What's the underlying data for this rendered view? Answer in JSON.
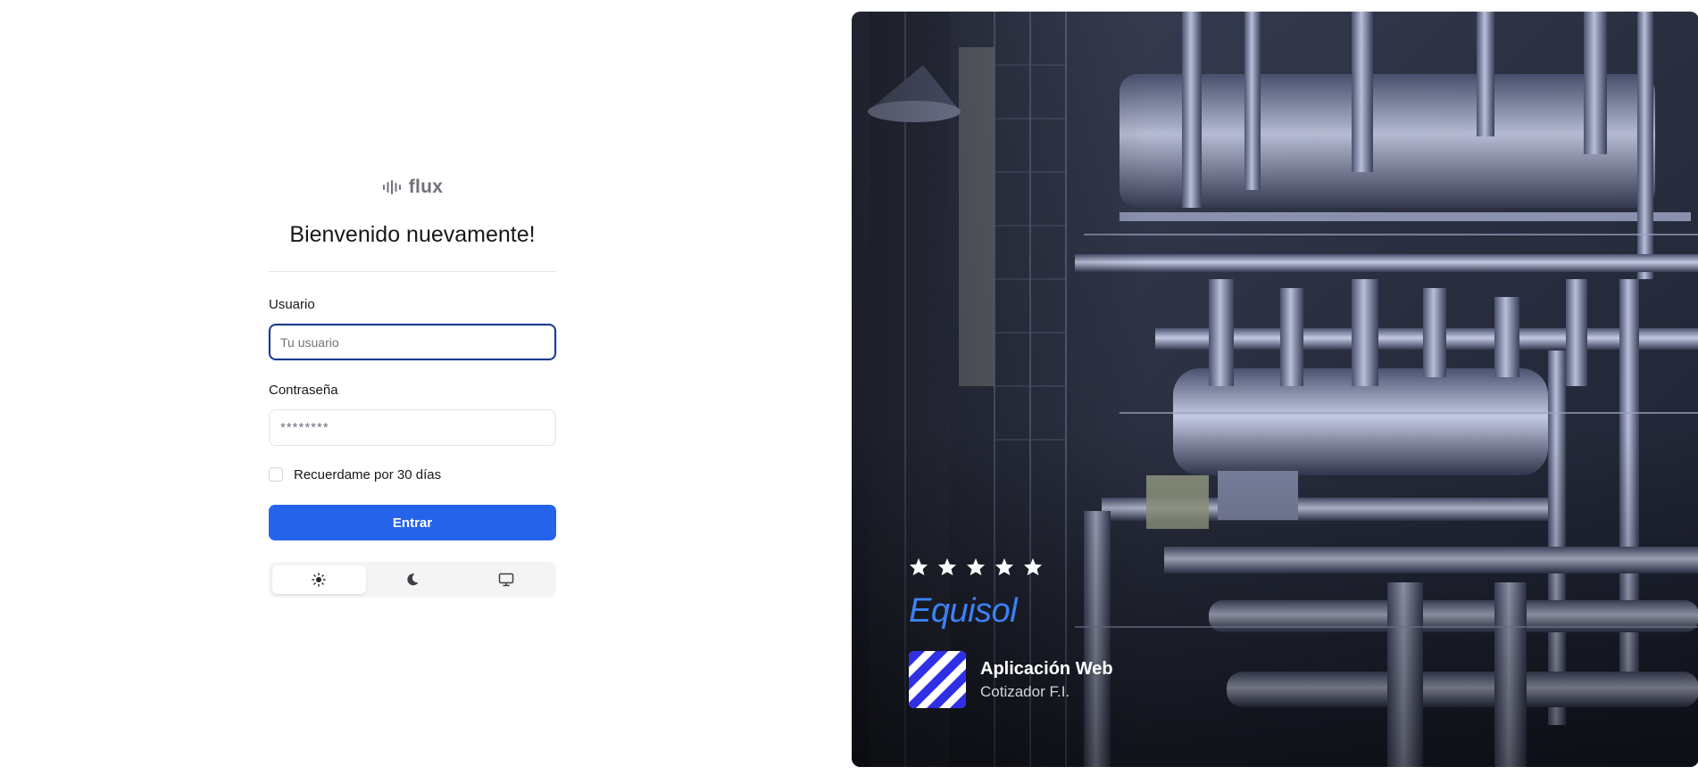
{
  "brand": {
    "name": "flux",
    "icon": "waveform-icon"
  },
  "login": {
    "title": "Bienvenido nuevamente!",
    "username_label": "Usuario",
    "username_placeholder": "Tu usuario",
    "password_label": "Contraseña",
    "password_placeholder": "********",
    "remember_label": "Recuerdame por 30 días",
    "remember_checked": false,
    "submit_label": "Entrar"
  },
  "theme_switcher": {
    "options": [
      {
        "icon": "sun-icon",
        "label": "Light"
      },
      {
        "icon": "moon-icon",
        "label": "Dark"
      },
      {
        "icon": "monitor-icon",
        "label": "System"
      }
    ],
    "selected": "Light"
  },
  "showcase": {
    "rating": 5,
    "rating_max": 5,
    "company": "Equisol",
    "app_title": "Aplicación Web",
    "app_subtitle": "Cotizador F.I."
  },
  "colors": {
    "primary": "#2563eb",
    "brand_blue": "#3b82f6",
    "app_logo": "#2f2fe6",
    "focus_border": "#1e3a8a"
  }
}
